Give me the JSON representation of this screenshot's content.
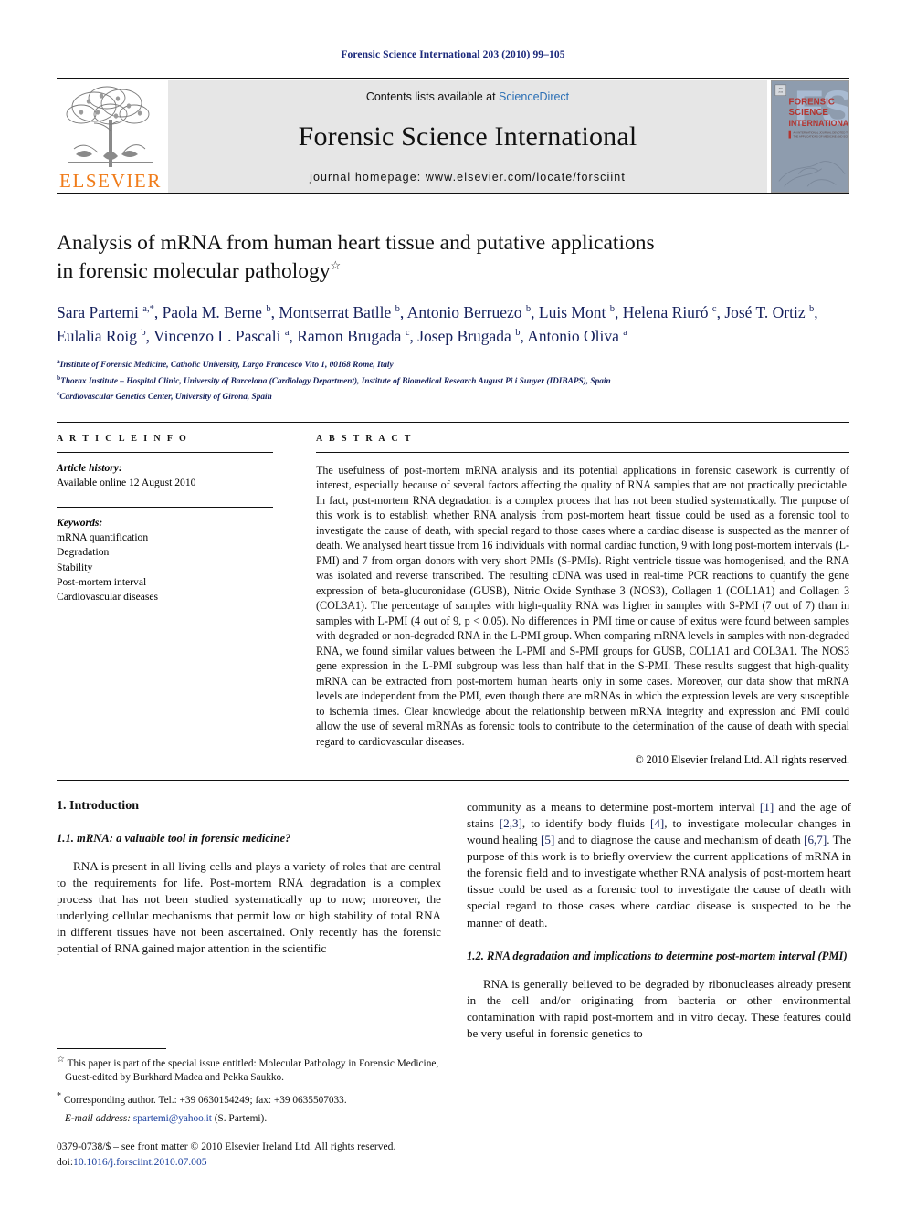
{
  "running_head": "Forensic Science International 203 (2010) 99–105",
  "masthead": {
    "publisher_logo_text": "ELSEVIER",
    "contents_prefix": "Contents lists available at ",
    "contents_link": "ScienceDirect",
    "journal_title": "Forensic Science International",
    "homepage_line": "journal homepage: www.elsevier.com/locate/forsciint",
    "cover": {
      "line1": "FORENSIC",
      "line2": "SCIENCE",
      "line3": "INTERNATIONAL",
      "big_mark": "FSI",
      "strap": "AN INTERNATIONAL JOURNAL DEVOTED TO THE APPLICATIONS OF MEDICINE AND SCIENCE IN THE ADMINISTRATION OF JUSTICE"
    }
  },
  "article": {
    "title_line1": "Analysis of mRNA from human heart tissue and putative applications",
    "title_line2": "in forensic molecular pathology",
    "title_mark": "☆",
    "authors_html": "Sara Partemi <sup>a,*</sup>, Paola M. Berne <sup>b</sup>, Montserrat Batlle <sup>b</sup>, Antonio Berruezo <sup>b</sup>, Luis Mont <sup>b</sup>, Helena Riuró <sup>c</sup>, José T. Ortiz <sup>b</sup>, Eulalia Roig <sup>b</sup>, Vincenzo L. Pascali <sup>a</sup>, Ramon Brugada <sup>c</sup>, Josep Brugada <sup>b</sup>, Antonio Oliva <sup>a</sup>",
    "affiliations": [
      {
        "mark": "a",
        "text": "Institute of Forensic Medicine, Catholic University, Largo Francesco Vito 1, 00168 Rome, Italy"
      },
      {
        "mark": "b",
        "text": "Thorax Institute – Hospital Clinic, University of Barcelona (Cardiology Department), Institute of Biomedical Research August Pi i Sunyer (IDIBAPS), Spain"
      },
      {
        "mark": "c",
        "text": "Cardiovascular Genetics Center, University of Girona, Spain"
      }
    ]
  },
  "article_info": {
    "heading": "A R T I C L E   I N F O",
    "history_label": "Article history:",
    "history_value": "Available online 12 August 2010",
    "keywords_label": "Keywords:",
    "keywords": [
      "mRNA quantification",
      "Degradation",
      "Stability",
      "Post-mortem interval",
      "Cardiovascular diseases"
    ]
  },
  "abstract": {
    "heading": "A B S T R A C T",
    "text": "The usefulness of post-mortem mRNA analysis and its potential applications in forensic casework is currently of interest, especially because of several factors affecting the quality of RNA samples that are not practically predictable. In fact, post-mortem RNA degradation is a complex process that has not been studied systematically. The purpose of this work is to establish whether RNA analysis from post-mortem heart tissue could be used as a forensic tool to investigate the cause of death, with special regard to those cases where a cardiac disease is suspected as the manner of death. We analysed heart tissue from 16 individuals with normal cardiac function, 9 with long post-mortem intervals (L-PMI) and 7 from organ donors with very short PMIs (S-PMIs). Right ventricle tissue was homogenised, and the RNA was isolated and reverse transcribed. The resulting cDNA was used in real-time PCR reactions to quantify the gene expression of beta-glucuronidase (GUSB), Nitric Oxide Synthase 3 (NOS3), Collagen 1 (COL1A1) and Collagen 3 (COL3A1). The percentage of samples with high-quality RNA was higher in samples with S-PMI (7 out of 7) than in samples with L-PMI (4 out of 9, p < 0.05). No differences in PMI time or cause of exitus were found between samples with degraded or non-degraded RNA in the L-PMI group. When comparing mRNA levels in samples with non-degraded RNA, we found similar values between the L-PMI and S-PMI groups for GUSB, COL1A1 and COL3A1. The NOS3 gene expression in the L-PMI subgroup was less than half that in the S-PMI. These results suggest that high-quality mRNA can be extracted from post-mortem human hearts only in some cases. Moreover, our data show that mRNA levels are independent from the PMI, even though there are mRNAs in which the expression levels are very susceptible to ischemia times. Clear knowledge about the relationship between mRNA integrity and expression and PMI could allow the use of several mRNAs as forensic tools to contribute to the determination of the cause of death with special regard to cardiovascular diseases.",
    "copyright": "© 2010 Elsevier Ireland Ltd. All rights reserved."
  },
  "body": {
    "section1_heading": "1. Introduction",
    "subsection11_heading": "1.1. mRNA: a valuable tool in forensic medicine?",
    "para1_left": "RNA is present in all living cells and plays a variety of roles that are central to the requirements for life. Post-mortem RNA degradation is a complex process that has not been studied systematically up to now; moreover, the underlying cellular mechanisms that permit low or high stability of total RNA in different tissues have not been ascertained. Only recently has the forensic potential of RNA gained major attention in the scientific",
    "para1_right_html": "community as a means to determine post-mortem interval <span class=\"ref\">[1]</span> and the age of stains <span class=\"ref\">[2,3]</span>, to identify body fluids <span class=\"ref\">[4]</span>, to investigate molecular changes in wound healing <span class=\"ref\">[5]</span> and to diagnose the cause and mechanism of death <span class=\"ref\">[6,7]</span>. The purpose of this work is to briefly overview the current applications of mRNA in the forensic field and to investigate whether RNA analysis of post-mortem heart tissue could be used as a forensic tool to investigate the cause of death with special regard to those cases where cardiac disease is suspected to be the manner of death.",
    "subsection12_heading": "1.2. RNA degradation and implications to determine post-mortem interval (PMI)",
    "para2_right": "RNA is generally believed to be degraded by ribonucleases already present in the cell and/or originating from bacteria or other environmental contamination with rapid post-mortem and in vitro decay. These features could be very useful in forensic genetics to"
  },
  "footnotes": {
    "fn1_html": "<span class=\"mark\">☆</span> This paper is part of the special issue entitled: Molecular Pathology in Forensic Medicine, Guest-edited by Burkhard Madea and Pekka Saukko.",
    "fn2_html": "<span class=\"mark\">*</span> Corresponding author. Tel.: +39 0630154249; fax: +39 0635507033.",
    "fn3_html": "<span class=\"em\">E-mail address:</span> <span class=\"linkblue\">spartemi@yahoo.it</span> (S. Partemi)."
  },
  "imprint": {
    "line1": "0379-0738/$ – see front matter © 2010 Elsevier Ireland Ltd. All rights reserved.",
    "doi_label": "doi:",
    "doi_value": "10.1016/j.forsciint.2010.07.005"
  }
}
